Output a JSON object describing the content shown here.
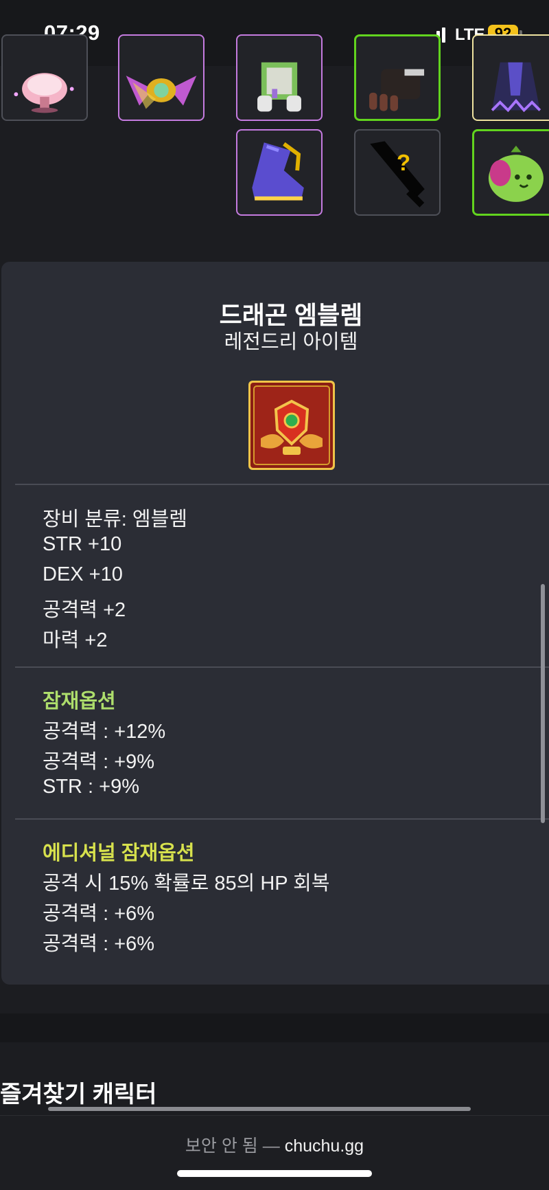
{
  "status_bar": {
    "time": "07:29",
    "network": "LTE",
    "battery": "92"
  },
  "equipment_slots": [
    {
      "icon": "pink-mushroom-item-icon",
      "border": "gray"
    },
    {
      "icon": "jeweled-ribbon-item-icon",
      "border": "purple"
    },
    {
      "icon": "white-armor-item-icon",
      "border": "purple"
    },
    {
      "icon": "dark-glove-item-icon",
      "border": "green"
    },
    {
      "icon": "dark-cape-item-icon",
      "border": "yellow"
    },
    {
      "icon": "purple-shoe-item-icon",
      "border": "purple"
    },
    {
      "icon": "mystery-weapon-item-icon",
      "border": "gray"
    },
    {
      "icon": "green-bag-item-icon",
      "border": "green"
    }
  ],
  "item": {
    "name": "드래곤 엠블렘",
    "grade": "레전드리 아이템",
    "icon": "dragon-emblem-icon",
    "stats": [
      "장비 분류: 엠블렘",
      "STR +10",
      "DEX +10",
      "공격력 +2",
      "마력 +2"
    ],
    "potential": {
      "title": "잠재옵션",
      "lines": [
        "공격력 : +12%",
        "공격력 : +9%",
        "STR : +9%"
      ]
    },
    "additional_potential": {
      "title": "에디셔널 잠재옵션",
      "lines": [
        "공격 시 15% 확률로 85의 HP 회복",
        "공격력 : +6%",
        "공격력 : +6%"
      ]
    }
  },
  "favorites": {
    "title": "즐겨찾기 캐릭터"
  },
  "browser": {
    "insecure_label": "보안 안 됨 —",
    "domain": "chuchu.gg"
  },
  "colors": {
    "background": "#1c1d21",
    "card": "#2b2d35",
    "potential_title": "#aede6c",
    "additional_title": "#d7e14d",
    "battery": "#f4c21b",
    "border_purple": "#c57be0",
    "border_green": "#62d41e",
    "border_yellow": "#efe3a0"
  }
}
